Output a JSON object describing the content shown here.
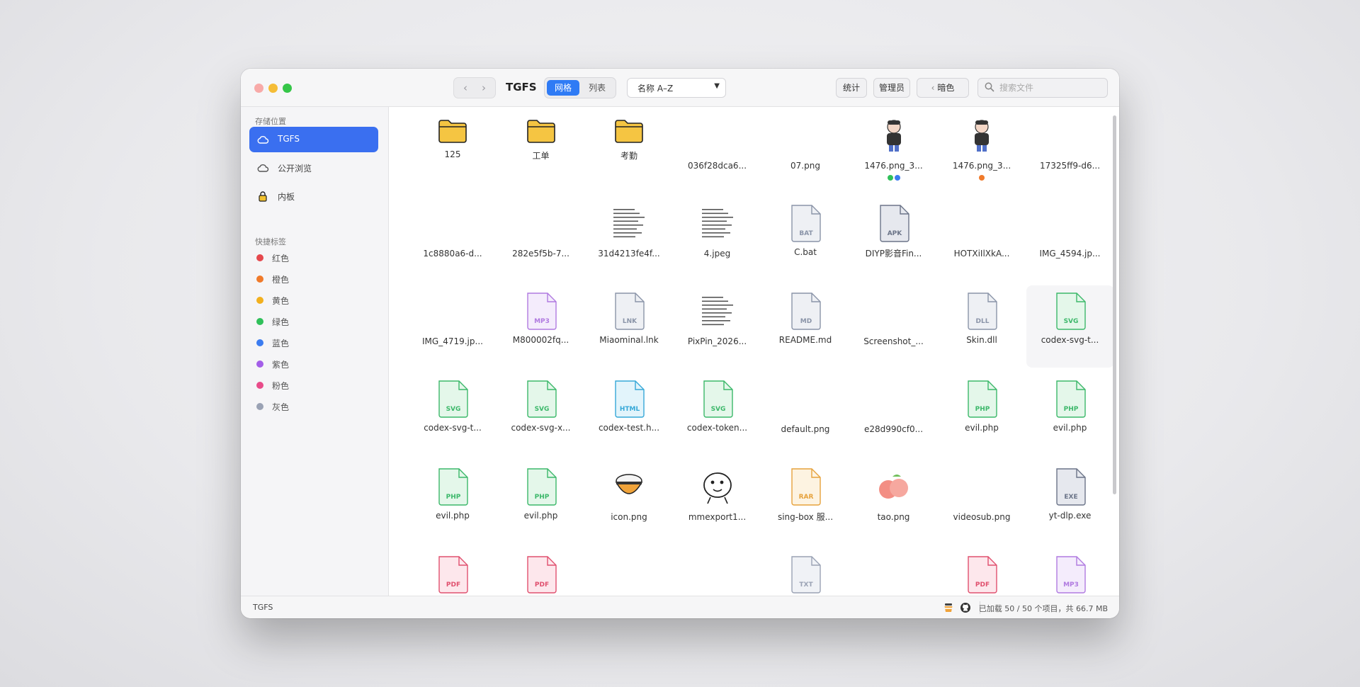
{
  "window": {
    "title": "TGFS",
    "view_modes": {
      "grid": "网格",
      "list": "列表"
    },
    "sort": {
      "selected": "名称 A–Z"
    },
    "toolbar": {
      "stats": "统计",
      "admin": "管理员",
      "theme": "暗色"
    },
    "search": {
      "placeholder": "搜索文件"
    }
  },
  "sidebar": {
    "storage_title": "存储位置",
    "storage": [
      {
        "label": "TGFS",
        "icon": "cloud-icon",
        "active": true
      },
      {
        "label": "公开浏览",
        "icon": "cloud-icon",
        "active": false
      },
      {
        "label": "内板",
        "icon": "lock-icon",
        "active": false
      }
    ],
    "tags_title": "快捷标签",
    "tags": [
      {
        "label": "红色",
        "color": "#e5484d"
      },
      {
        "label": "橙色",
        "color": "#f07a2a"
      },
      {
        "label": "黄色",
        "color": "#f2b01e"
      },
      {
        "label": "绿色",
        "color": "#30c05a"
      },
      {
        "label": "蓝色",
        "color": "#3b7cf0"
      },
      {
        "label": "紫色",
        "color": "#a35ee8"
      },
      {
        "label": "粉色",
        "color": "#e84c8a"
      },
      {
        "label": "灰色",
        "color": "#9aa2b4"
      }
    ]
  },
  "files": [
    {
      "name": "125",
      "kind": "folder"
    },
    {
      "name": "工单",
      "kind": "folder"
    },
    {
      "name": "考勤",
      "kind": "folder"
    },
    {
      "name": "036f28dca6...",
      "kind": "image",
      "thumb": "#c79a7a"
    },
    {
      "name": "07.png",
      "kind": "image",
      "thumb": "#4f6c7e"
    },
    {
      "name": "1476.png_3...",
      "kind": "image",
      "thumb": "checker",
      "tags": [
        "#30c05a",
        "#3b7cf0"
      ]
    },
    {
      "name": "1476.png_3...",
      "kind": "image",
      "thumb": "checker",
      "tags": [
        "#f07a2a"
      ]
    },
    {
      "name": "17325ff9-d6...",
      "kind": "image",
      "thumb": "#6f7fa8"
    },
    {
      "name": "1c8880a6-d...",
      "kind": "image",
      "thumb": "#b7a0c6"
    },
    {
      "name": "282e5f5b-7...",
      "kind": "image",
      "thumb": "#7c7062"
    },
    {
      "name": "31d4213fe4f...",
      "kind": "image",
      "thumb": "doc"
    },
    {
      "name": "4.jpeg",
      "kind": "image",
      "thumb": "doc"
    },
    {
      "name": "C.bat",
      "kind": "doc",
      "ext": "BAT",
      "color": "#8a94a8",
      "bg": "#eef0f4"
    },
    {
      "name": "DIYP影音Fin...",
      "kind": "doc",
      "ext": "APK",
      "color": "#6b7488",
      "bg": "#e6e8ee"
    },
    {
      "name": "HOTXiIlXkA...",
      "kind": "image",
      "thumb": "#1c1d3c"
    },
    {
      "name": "IMG_4594.jp...",
      "kind": "image",
      "thumb": "#8b9476"
    },
    {
      "name": "IMG_4719.jp...",
      "kind": "image",
      "thumb": "#ededed"
    },
    {
      "name": "M800002fq...",
      "kind": "doc",
      "ext": "MP3",
      "color": "#b07ae0",
      "bg": "#f4ecfc"
    },
    {
      "name": "Miaominal.lnk",
      "kind": "doc",
      "ext": "LNK",
      "color": "#8a94a8",
      "bg": "#eef0f4"
    },
    {
      "name": "PixPin_2026...",
      "kind": "image",
      "thumb": "doc"
    },
    {
      "name": "README.md",
      "kind": "doc",
      "ext": "MD",
      "color": "#8a94a8",
      "bg": "#eef0f4"
    },
    {
      "name": "Screenshot_...",
      "kind": "image",
      "thumb": "#e6dbd3"
    },
    {
      "name": "Skin.dll",
      "kind": "doc",
      "ext": "DLL",
      "color": "#8a94a8",
      "bg": "#eef0f4"
    },
    {
      "name": "codex-svg-t...",
      "kind": "doc",
      "ext": "SVG",
      "color": "#3cb86a",
      "bg": "#e4f7ea",
      "hl": true
    },
    {
      "name": "codex-svg-t...",
      "kind": "doc",
      "ext": "SVG",
      "color": "#3cb86a",
      "bg": "#e4f7ea"
    },
    {
      "name": "codex-svg-x...",
      "kind": "doc",
      "ext": "SVG",
      "color": "#3cb86a",
      "bg": "#e4f7ea"
    },
    {
      "name": "codex-test.h...",
      "kind": "doc",
      "ext": "HTML",
      "color": "#36a8d8",
      "bg": "#e2f4fb"
    },
    {
      "name": "codex-token...",
      "kind": "doc",
      "ext": "SVG",
      "color": "#3cb86a",
      "bg": "#e4f7ea"
    },
    {
      "name": "default.png",
      "kind": "image",
      "thumb": "telegram"
    },
    {
      "name": "e28d990cf0...",
      "kind": "image",
      "thumb": "#d9c25a"
    },
    {
      "name": "evil.php",
      "kind": "doc",
      "ext": "PHP",
      "color": "#3cb86a",
      "bg": "#e4f7ea"
    },
    {
      "name": "evil.php",
      "kind": "doc",
      "ext": "PHP",
      "color": "#3cb86a",
      "bg": "#e4f7ea"
    },
    {
      "name": "evil.php",
      "kind": "doc",
      "ext": "PHP",
      "color": "#3cb86a",
      "bg": "#e4f7ea"
    },
    {
      "name": "evil.php",
      "kind": "doc",
      "ext": "PHP",
      "color": "#3cb86a",
      "bg": "#e4f7ea"
    },
    {
      "name": "icon.png",
      "kind": "image",
      "thumb": "bowl"
    },
    {
      "name": "mmexport1...",
      "kind": "image",
      "thumb": "doodle"
    },
    {
      "name": "sing-box 服...",
      "kind": "doc",
      "ext": "RAR",
      "color": "#e6a23c",
      "bg": "#fdf3e1"
    },
    {
      "name": "tao.png",
      "kind": "image",
      "thumb": "peach"
    },
    {
      "name": "videosub.png",
      "kind": "image",
      "thumb": "#3a2a2a"
    },
    {
      "name": "yt-dlp.exe",
      "kind": "doc",
      "ext": "EXE",
      "color": "#6b7488",
      "bg": "#e6e8ee"
    },
    {
      "name": "",
      "kind": "doc",
      "ext": "PDF",
      "color": "#e0506e",
      "bg": "#fde7ec"
    },
    {
      "name": "",
      "kind": "doc",
      "ext": "PDF",
      "color": "#e0506e",
      "bg": "#fde7ec"
    },
    {
      "name": "",
      "kind": "image",
      "thumb": "#e8d7c8"
    },
    {
      "name": "",
      "kind": "image",
      "thumb": "#5a7a4a"
    },
    {
      "name": "",
      "kind": "doc",
      "ext": "TXT",
      "color": "#9aa2b4",
      "bg": "#f0f2f6"
    },
    {
      "name": "",
      "kind": "image",
      "thumb": "#6ab0e0"
    },
    {
      "name": "",
      "kind": "doc",
      "ext": "PDF",
      "color": "#e0506e",
      "bg": "#fde7ec"
    },
    {
      "name": "",
      "kind": "doc",
      "ext": "MP3",
      "color": "#b07ae0",
      "bg": "#f4ecfc"
    }
  ],
  "status": {
    "left": "TGFS",
    "right": "已加载 50 / 50 个项目，共 66.7 MB",
    "icons": [
      "coffee-icon",
      "github-icon"
    ]
  }
}
